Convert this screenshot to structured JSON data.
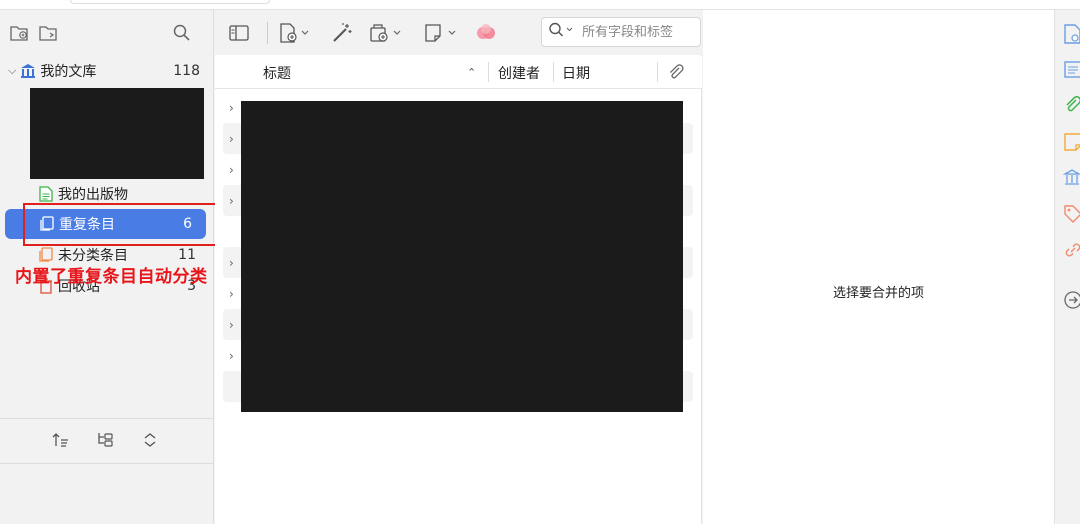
{
  "left_pane": {
    "library": {
      "label": "我的文库",
      "count": "118"
    },
    "items": [
      {
        "label": "我的出版物",
        "count": ""
      },
      {
        "label": "重复条目",
        "count": "6"
      },
      {
        "label": "未分类条目",
        "count": "11"
      },
      {
        "label": "回收站",
        "count": "3"
      }
    ]
  },
  "annotation": {
    "text": "内置了重复条目自动分类"
  },
  "items_pane": {
    "search": {
      "placeholder": "所有字段和标签"
    },
    "columns": {
      "title": "标题",
      "creator": "创建者",
      "date": "日期"
    }
  },
  "merge_pane": {
    "message": "选择要合并的项"
  },
  "colors": {
    "selection": "#4a7ce6",
    "annotation": "#e0201c",
    "accent_green": "#3bb54a",
    "accent_orange": "#f4a93b"
  }
}
